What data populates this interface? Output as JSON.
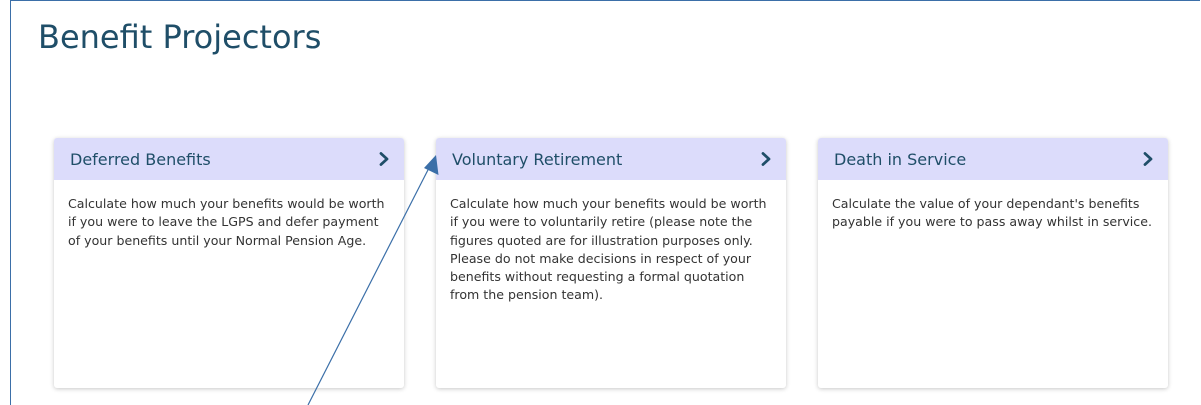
{
  "page": {
    "title": "Benefit Projectors"
  },
  "cards": [
    {
      "title": "Deferred Benefits",
      "description": "Calculate how much your benefits would be worth if you were to leave the LGPS and defer payment of your benefits until your Normal Pension Age."
    },
    {
      "title": "Voluntary Retirement",
      "description": "Calculate how much your benefits would be worth if you were to voluntarily retire (please note the figures quoted are for illustration purposes only. Please do not make decisions in respect of your benefits without requesting a formal quotation from the pension team)."
    },
    {
      "title": "Death in Service",
      "description": "Calculate the value of your dependant's benefits payable if you were to pass away whilst in service."
    }
  ],
  "colors": {
    "title": "#1f4e68",
    "card_header": "#dcdcfb",
    "annotation_arrow": "#3b6fa8"
  },
  "icons": {
    "card_action": "chevron-right-icon"
  }
}
